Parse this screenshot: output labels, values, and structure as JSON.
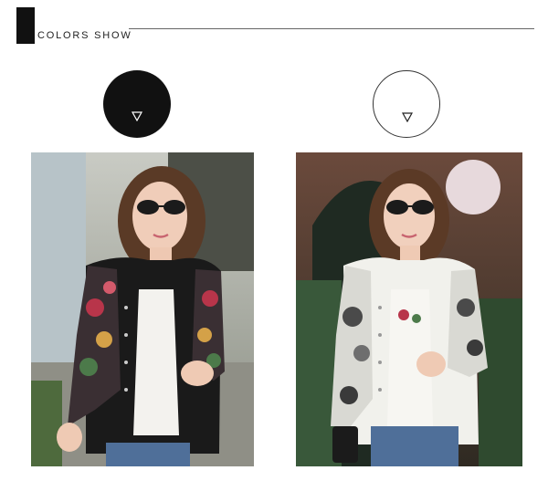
{
  "header": {
    "title": "COLORS SHOW"
  },
  "swatches": [
    {
      "name": "black",
      "color": "#111111",
      "icon": "triangle-down-icon"
    },
    {
      "name": "white",
      "color": "#ffffff",
      "icon": "triangle-down-icon"
    }
  ],
  "colors": {
    "black_jacket": "#1a1a1a",
    "white_jacket": "#f1f1ec",
    "floral_red": "#b8354a",
    "floral_green": "#4c7a4a",
    "denim": "#4f6f99"
  }
}
